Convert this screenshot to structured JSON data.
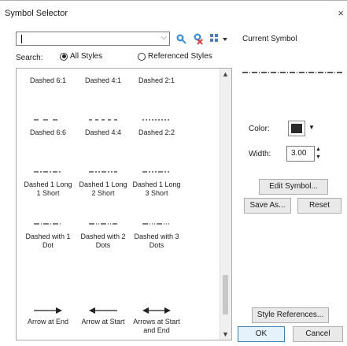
{
  "window": {
    "title": "Symbol Selector",
    "close": "×"
  },
  "search": {
    "label": "Search:",
    "value": ""
  },
  "filters": [
    {
      "label": "All Styles",
      "selected": true
    },
    {
      "label": "Referenced Styles",
      "selected": false
    }
  ],
  "symbols": [
    {
      "label": "Dashed 6:1",
      "dash": "6 1"
    },
    {
      "label": "Dashed 4:1",
      "dash": "4 1"
    },
    {
      "label": "Dashed 2:1",
      "dash": "2 1"
    },
    {
      "label": "Dashed 6:6",
      "dash": "6 6"
    },
    {
      "label": "Dashed 4:4",
      "dash": "4 4"
    },
    {
      "label": "Dashed 2:2",
      "dash": "2 2"
    },
    {
      "label": "Dashed 1 Long 1 Short",
      "dash": "6 2 2 2"
    },
    {
      "label": "Dashed 1 Long 2 Short",
      "dash": "6 2 2 2 2 2"
    },
    {
      "label": "Dashed 1 Long 3 Short",
      "dash": "6 2 2 2 2 2 2 2"
    },
    {
      "label": "Dashed with 1 Dot",
      "dash": "7 2 1 2"
    },
    {
      "label": "Dashed with 2 Dots",
      "dash": "7 2 1 2 1 2"
    },
    {
      "label": "Dashed with 3 Dots",
      "dash": "7 2 1 2 1 2 1 2"
    },
    {
      "label": "Arrow at End",
      "arrow": "end"
    },
    {
      "label": "Arrow at Start",
      "arrow": "start"
    },
    {
      "label": "Arrows at Start and End",
      "arrow": "both"
    }
  ],
  "current": {
    "label": "Current Symbol",
    "dash": "7 2 1 2"
  },
  "properties": {
    "color_label": "Color:",
    "color": "#2b2b2b",
    "width_label": "Width:",
    "width": "3.00"
  },
  "buttons": {
    "edit": "Edit Symbol...",
    "save_as": "Save As...",
    "reset": "Reset",
    "style_refs": "Style References...",
    "ok": "OK",
    "cancel": "Cancel"
  }
}
